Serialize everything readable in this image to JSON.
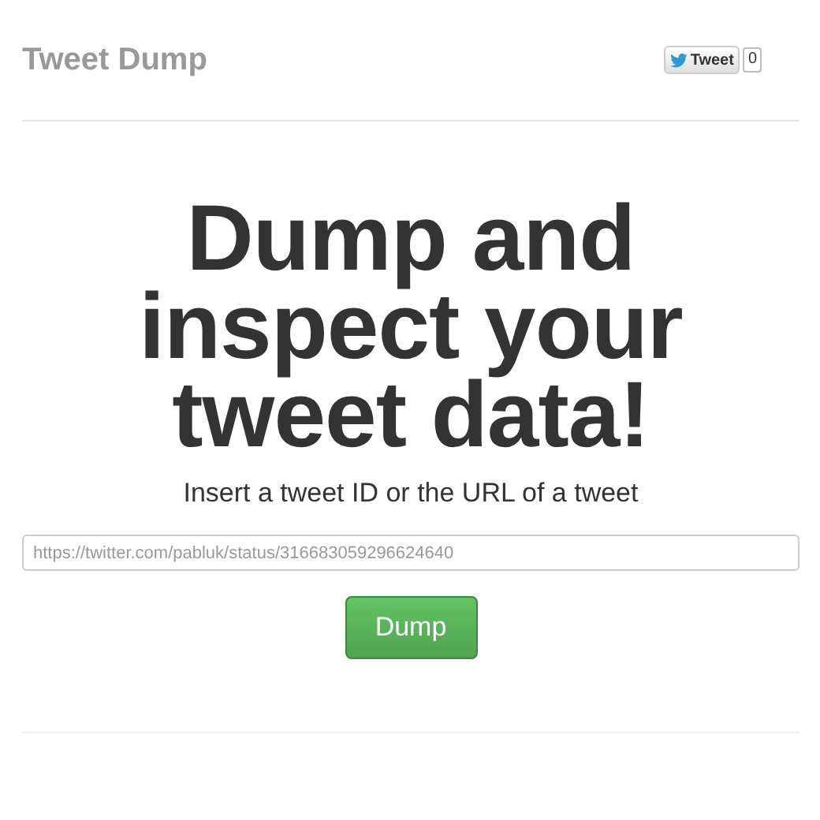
{
  "header": {
    "title": "Tweet Dump",
    "tweet_button": {
      "label": "Tweet",
      "count": "0"
    }
  },
  "hero": {
    "heading": "Dump and inspect your tweet data!",
    "subtitle": "Insert a tweet ID or the URL of a tweet"
  },
  "form": {
    "placeholder": "https://twitter.com/pabluk/status/316683059296624640",
    "button": "Dump"
  }
}
